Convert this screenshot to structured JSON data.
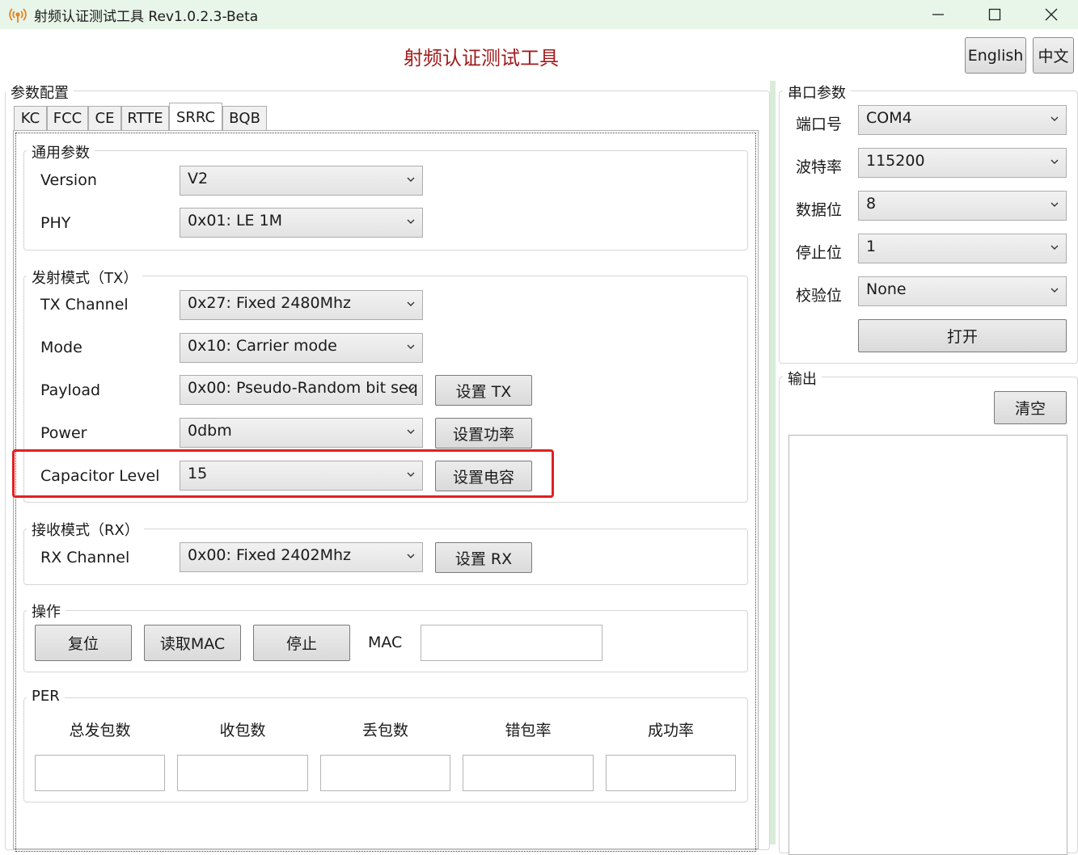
{
  "window": {
    "title": "射频认证测试工具 Rev1.0.2.3-Beta",
    "minimize_icon": "minimize-icon",
    "maximize_icon": "maximize-icon",
    "close_icon": "close-icon"
  },
  "header": {
    "title": "射频认证测试工具",
    "english_label": "English",
    "chinese_label": "中文"
  },
  "params": {
    "legend": "参数配置",
    "tabs": [
      {
        "label": "KC"
      },
      {
        "label": "FCC"
      },
      {
        "label": "CE"
      },
      {
        "label": "RTTE"
      },
      {
        "label": "SRRC"
      },
      {
        "label": "BQB"
      }
    ],
    "active_tab": "SRRC",
    "general": {
      "legend": "通用参数",
      "version_label": "Version",
      "version_value": "V2",
      "phy_label": "PHY",
      "phy_value": "0x01: LE 1M"
    },
    "tx": {
      "legend": "发射模式（TX）",
      "channel_label": "TX Channel",
      "channel_value": "0x27: Fixed 2480Mhz",
      "mode_label": "Mode",
      "mode_value": "0x10: Carrier mode",
      "payload_label": "Payload",
      "payload_value": "0x00: Pseudo-Random bit seq",
      "set_tx_label": "设置 TX",
      "power_label": "Power",
      "power_value": "0dbm",
      "set_power_label": "设置功率",
      "capacitor_label": "Capacitor Level",
      "capacitor_value": "15",
      "set_capacitor_label": "设置电容"
    },
    "rx": {
      "legend": "接收模式（RX）",
      "channel_label": "RX Channel",
      "channel_value": "0x00: Fixed 2402Mhz",
      "set_rx_label": "设置 RX"
    },
    "ops": {
      "legend": "操作",
      "reset_label": "复位",
      "read_mac_label": "读取MAC",
      "stop_label": "停止",
      "mac_label": "MAC",
      "mac_value": ""
    },
    "per": {
      "legend": "PER",
      "columns": [
        "总发包数",
        "收包数",
        "丢包数",
        "错包率",
        "成功率"
      ],
      "values": [
        "",
        "",
        "",
        "",
        ""
      ]
    }
  },
  "serial": {
    "legend": "串口参数",
    "port_label": "端口号",
    "port_value": "COM4",
    "baud_label": "波特率",
    "baud_value": "115200",
    "databits_label": "数据位",
    "databits_value": "8",
    "stopbits_label": "停止位",
    "stopbits_value": "1",
    "parity_label": "校验位",
    "parity_value": "None",
    "open_label": "打开"
  },
  "output": {
    "legend": "输出",
    "clear_label": "清空",
    "text": ""
  },
  "colors": {
    "title_red": "#a01c1c",
    "highlight_red": "#e02020",
    "titlebar_green": "#e8f5e9"
  }
}
